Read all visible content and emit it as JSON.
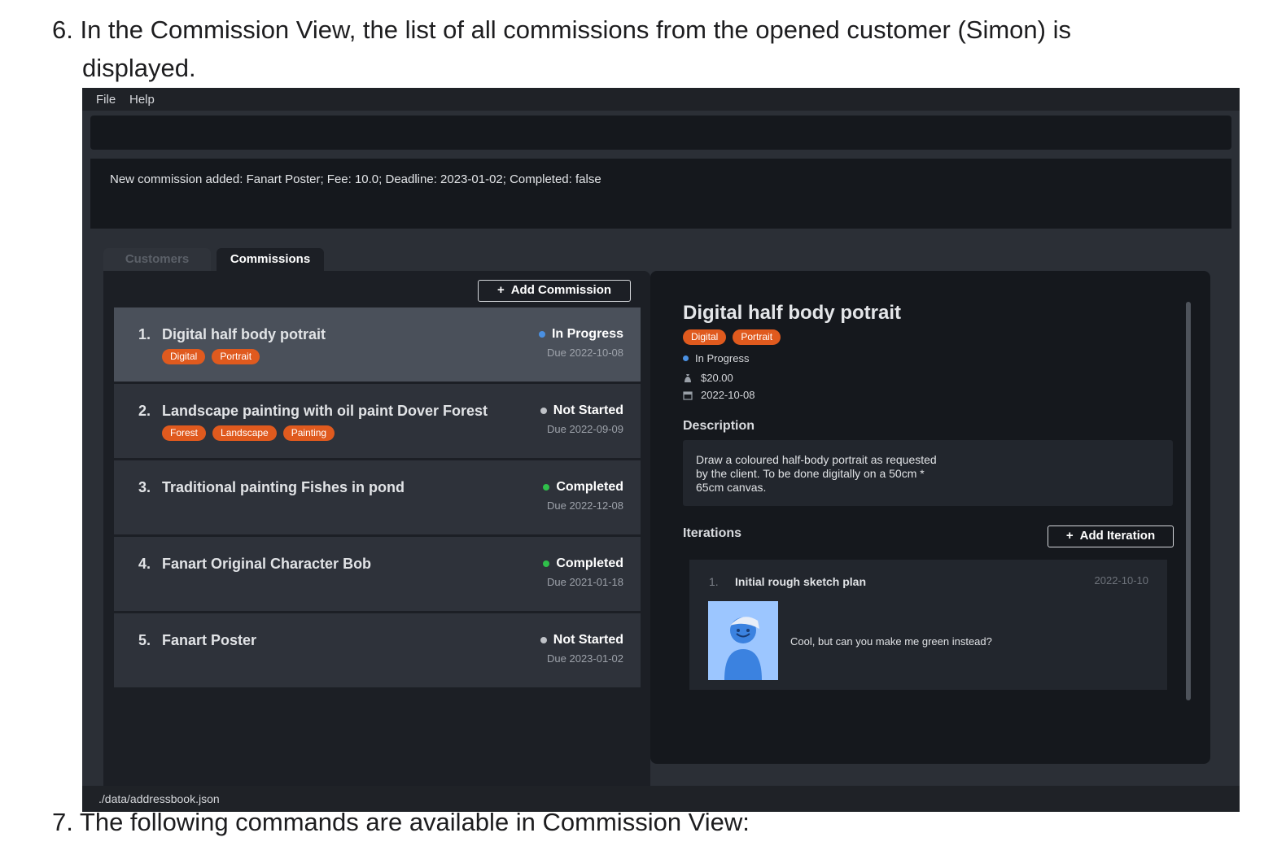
{
  "doc": {
    "step6_line1": "6. In the Commission View, the list of all commissions from the opened customer (Simon) is",
    "step6_line2": "displayed.",
    "step7": "7. The following commands are available in Commission View:"
  },
  "app": {
    "menu": [
      "File",
      "Help"
    ],
    "command_input": "",
    "result_message": "New commission added: Fanart Poster; Fee: 10.0; Deadline: 2023-01-02; Completed: false",
    "tabs": [
      {
        "label": "Customers",
        "active": false
      },
      {
        "label": "Commissions",
        "active": true
      }
    ],
    "add_commission_label": "Add Commission",
    "commissions": [
      {
        "index": "1.",
        "title": "Digital half body potrait",
        "tags": [
          "Digital",
          "Portrait"
        ],
        "status": "In Progress",
        "status_color": "#4a90e2",
        "due": "Due 2022-10-08",
        "selected": true
      },
      {
        "index": "2.",
        "title": "Landscape painting with oil paint Dover Forest",
        "tags": [
          "Forest",
          "Landscape",
          "Painting"
        ],
        "status": "Not Started",
        "status_color": "#bfc2c7",
        "due": "Due 2022-09-09",
        "selected": false
      },
      {
        "index": "3.",
        "title": "Traditional painting Fishes in pond",
        "tags": [],
        "status": "Completed",
        "status_color": "#2fbf4a",
        "due": "Due 2022-12-08",
        "selected": false
      },
      {
        "index": "4.",
        "title": "Fanart Original Character Bob",
        "tags": [],
        "status": "Completed",
        "status_color": "#2fbf4a",
        "due": "Due 2021-01-18",
        "selected": false
      },
      {
        "index": "5.",
        "title": "Fanart Poster",
        "tags": [],
        "status": "Not Started",
        "status_color": "#bfc2c7",
        "due": "Due 2023-01-02",
        "selected": false
      }
    ],
    "detail": {
      "title": "Digital half body potrait",
      "tags": [
        "Digital",
        "Portrait"
      ],
      "status": "In Progress",
      "status_color": "#4a90e2",
      "fee": "$20.00",
      "deadline": "2022-10-08",
      "description_heading": "Description",
      "description": "Draw a coloured half-body portrait as requested by the client. To be done digitally on a 50cm * 65cm canvas.",
      "iterations_heading": "Iterations",
      "add_iteration_label": "Add Iteration",
      "iterations": [
        {
          "index": "1.",
          "title": "Initial rough sketch plan",
          "date": "2022-10-10",
          "comment": "Cool, but can you make me green instead?"
        }
      ]
    },
    "status_bar": "./data/addressbook.json",
    "colors": {
      "tag": "#e05a1e",
      "background": "#2b2f36",
      "panel": "#1c1f25"
    }
  }
}
